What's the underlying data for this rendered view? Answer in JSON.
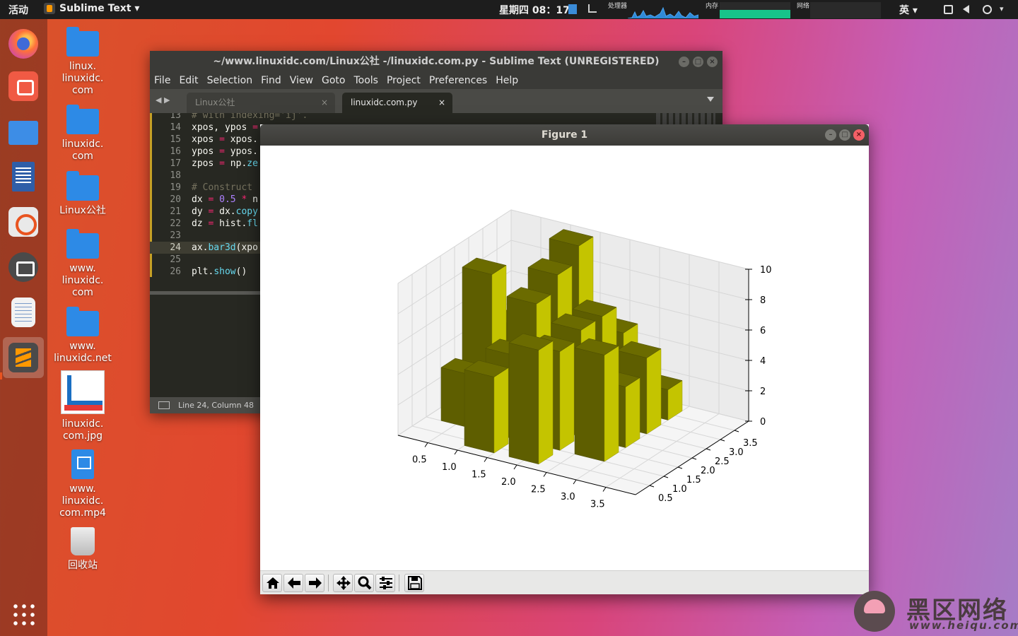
{
  "topbar": {
    "activities": "活动",
    "app_menu": "Sublime Text ▾",
    "clock": "星期四 08：17",
    "cpu_label": "处理器",
    "mem_label": "内存",
    "net_label": "网络",
    "ime": "英 ▾",
    "tray_arrow": "▾"
  },
  "desktop_icons": [
    {
      "label": "linux.\nlinuxidc.\ncom",
      "type": "folder"
    },
    {
      "label": "linuxidc.\ncom",
      "type": "folder"
    },
    {
      "label": "Linux公社",
      "type": "folder"
    },
    {
      "label": "www.\nlinuxidc.\ncom",
      "type": "folder"
    },
    {
      "label": "www.\nlinuxidc.net",
      "type": "folder"
    },
    {
      "label": "linuxidc.\ncom.jpg",
      "type": "image"
    },
    {
      "label": "www.\nlinuxidc.\ncom.mp4",
      "type": "video"
    },
    {
      "label": "回收站",
      "type": "trash"
    }
  ],
  "sublime": {
    "title": "~/www.linuxidc.com/Linux公社 -/linuxidc.com.py - Sublime Text (UNREGISTERED)",
    "menu": [
      "File",
      "Edit",
      "Selection",
      "Find",
      "View",
      "Goto",
      "Tools",
      "Project",
      "Preferences",
      "Help"
    ],
    "tabs": [
      {
        "label": "Linux公社 www.linuxidc.com.go",
        "close": "×"
      },
      {
        "label": "linuxidc.com.py",
        "close": "×"
      }
    ],
    "status": "Line 24, Column 48",
    "lines": [
      {
        "n": "13",
        "code": "# with indexing='ij'."
      },
      {
        "n": "14",
        "code": "xpos, ypos = "
      },
      {
        "n": "15",
        "code": "xpos = xpos."
      },
      {
        "n": "16",
        "code": "ypos = ypos."
      },
      {
        "n": "17",
        "code": "zpos = np.ze"
      },
      {
        "n": "18",
        "code": ""
      },
      {
        "n": "19",
        "code": "# Construct"
      },
      {
        "n": "20",
        "code": "dx = 0.5 * n"
      },
      {
        "n": "21",
        "code": "dy = dx.copy"
      },
      {
        "n": "22",
        "code": "dz = hist.fl"
      },
      {
        "n": "23",
        "code": ""
      },
      {
        "n": "24",
        "code": "ax.bar3d(xpo"
      },
      {
        "n": "25",
        "code": ""
      },
      {
        "n": "26",
        "code": "plt.show()"
      }
    ]
  },
  "figure": {
    "title": "Figure 1"
  },
  "colors": {
    "bar_top": "#6b6b00",
    "bar_front": "#5e5e00",
    "bar_side": "#c4c400",
    "sublime_bg": "#272822"
  },
  "chart_data": {
    "type": "bar3d",
    "x_ticks": [
      "0.5",
      "1.0",
      "1.5",
      "2.0",
      "2.5",
      "3.0",
      "3.5"
    ],
    "y_ticks": [
      "0.5",
      "1.0",
      "1.5",
      "2.0",
      "2.5",
      "3.0",
      "3.5"
    ],
    "z_ticks": [
      "0",
      "2",
      "4",
      "6",
      "8",
      "10"
    ],
    "zlim": [
      0,
      10
    ],
    "bars": [
      {
        "x": 0.25,
        "y": 1.75,
        "z": 9.2
      },
      {
        "x": 1.0,
        "y": 2.5,
        "z": 9.0
      },
      {
        "x": 1.0,
        "y": 3.25,
        "z": 10.0
      },
      {
        "x": 1.75,
        "y": 2.5,
        "z": 7.0
      },
      {
        "x": 1.75,
        "y": 3.25,
        "z": 5.0
      },
      {
        "x": 0.25,
        "y": 2.5,
        "z": 5.0
      },
      {
        "x": 0.25,
        "y": 3.25,
        "z": 3.0
      },
      {
        "x": 2.5,
        "y": 2.5,
        "z": 5.0
      },
      {
        "x": 2.5,
        "y": 3.25,
        "z": 2.0
      },
      {
        "x": 0.25,
        "y": 1.0,
        "z": 3.5
      },
      {
        "x": 1.75,
        "y": 1.75,
        "z": 7.0
      },
      {
        "x": 1.0,
        "y": 1.75,
        "z": 8.0
      },
      {
        "x": 2.5,
        "y": 1.75,
        "z": 4.0
      },
      {
        "x": 1.0,
        "y": 1.0,
        "z": 5.5
      },
      {
        "x": 1.75,
        "y": 1.0,
        "z": 6.5
      },
      {
        "x": 1.0,
        "y": 0.25,
        "z": 5.0
      },
      {
        "x": 1.75,
        "y": 0.25,
        "z": 7.5
      },
      {
        "x": 2.5,
        "y": 1.0,
        "z": 7.0
      }
    ]
  },
  "watermark": {
    "title": "黑区网络",
    "url": "www.heiqu.com"
  }
}
